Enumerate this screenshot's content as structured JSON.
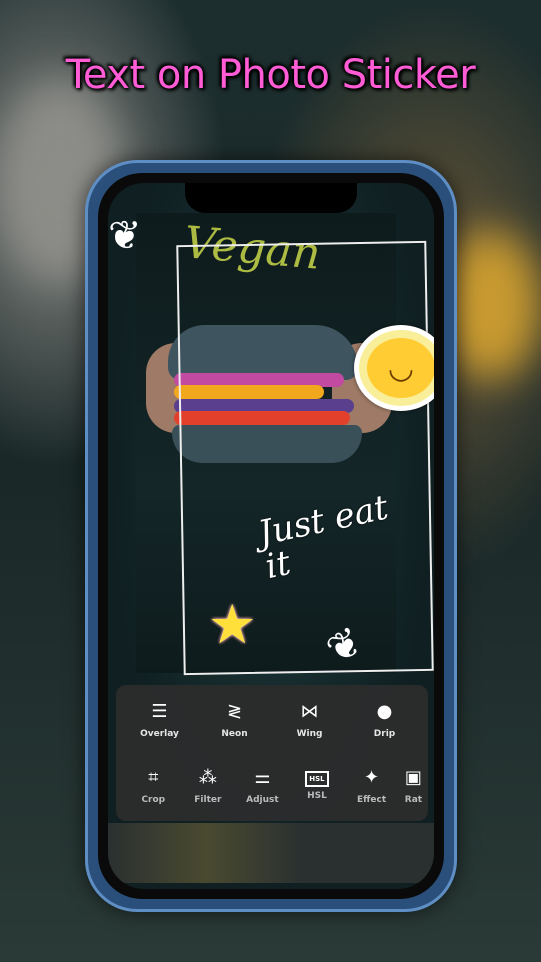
{
  "title": "Text on Photo Sticker",
  "photo": {
    "shirt_text": "Vegan",
    "sticker_text": "Just eat it"
  },
  "toolbar": {
    "row1": [
      {
        "label": "Overlay",
        "icon": "layers-icon"
      },
      {
        "label": "Neon",
        "icon": "zigzag-icon"
      },
      {
        "label": "Wing",
        "icon": "butterfly-icon"
      },
      {
        "label": "Drip",
        "icon": "drip-icon"
      }
    ],
    "row2": [
      {
        "label": "Crop",
        "icon": "crop-icon"
      },
      {
        "label": "Filter",
        "icon": "filter-circles-icon"
      },
      {
        "label": "Adjust",
        "icon": "sliders-icon"
      },
      {
        "label": "HSL",
        "icon": "hsl-icon"
      },
      {
        "label": "Effect",
        "icon": "magic-wand-icon"
      },
      {
        "label": "Rat",
        "icon": "ratio-icon"
      }
    ]
  },
  "colors": {
    "title": "#ff5cd6",
    "phone_frame": "#5e8ec4",
    "panel": "#2d2d2d"
  }
}
